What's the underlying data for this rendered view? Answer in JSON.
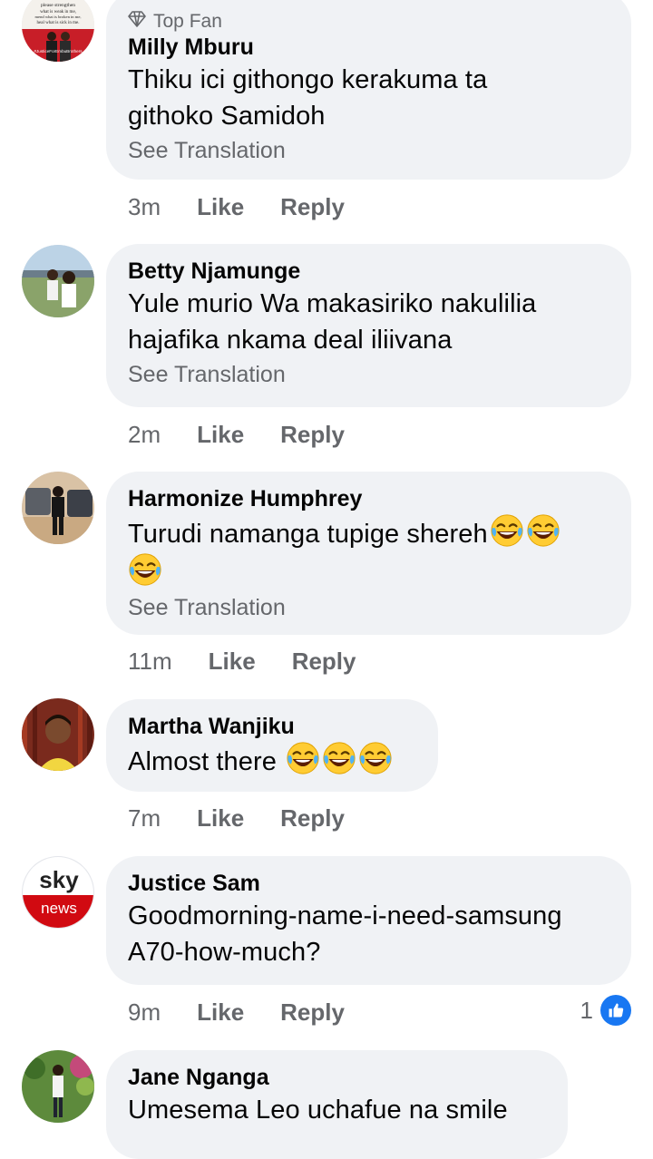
{
  "ui": {
    "see_translation": "See Translation",
    "like_label": "Like",
    "reply_label": "Reply"
  },
  "comments": [
    {
      "badge": "Top Fan",
      "author": "Milly Mburu",
      "lines": [
        "Thiku ici githongo kerakuma ta",
        "githoko  Samidoh"
      ],
      "time": "3m",
      "avatar_texts": [
        "please strengthen",
        "what is weak in me,",
        "mend what is broken in me,",
        "heal what is sick in me.",
        "#JusticeForEmbuBrothers"
      ]
    },
    {
      "author": "Betty Njamunge",
      "lines": [
        "Yule murio Wa makasiriko nakulilia",
        "hajafika nkama deal iliivana"
      ],
      "time": "2m"
    },
    {
      "author": "Harmonize Humphrey",
      "lines": [
        "Turudi namanga tupige shereh",
        ""
      ],
      "time": "11m"
    },
    {
      "author": "Martha Wanjiku",
      "lines": [
        "Almost there "
      ],
      "time": "7m"
    },
    {
      "author": "Justice Sam",
      "lines": [
        "Goodmorning-name-i-need-samsung",
        "A70-how-much?"
      ],
      "time": "9m",
      "reaction_count": "1",
      "avatar_texts": [
        "sky",
        "news"
      ]
    },
    {
      "author": "Jane Nganga",
      "lines": [
        "Umesema Leo uchafue na smile"
      ]
    }
  ],
  "colors": {
    "bubble": "#f0f2f5",
    "secondary_text": "#65676b",
    "like_blue": "#1877f2",
    "sky_red": "#d10a11"
  },
  "icons": [
    "diamond-icon",
    "laughing-emoji-icon",
    "like-reaction-icon"
  ]
}
